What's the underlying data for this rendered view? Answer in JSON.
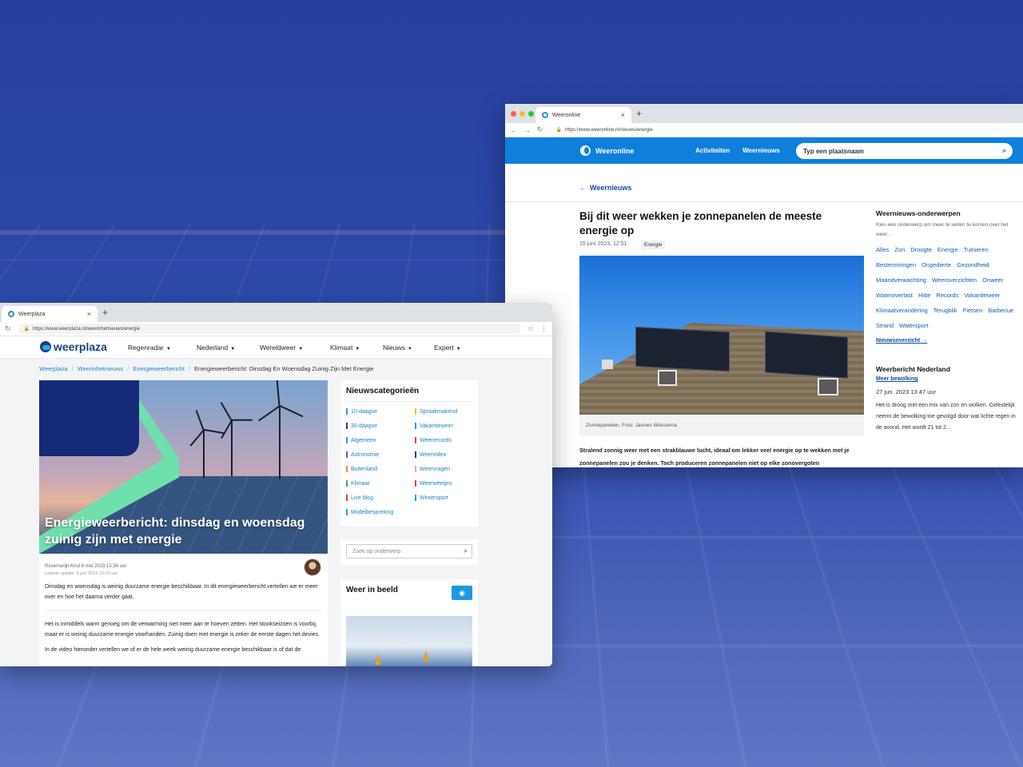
{
  "weeronline": {
    "tab_title": "Weeronline",
    "url": "https://www.weeronline.nl/nieuws/energie",
    "logo": "Weeronline",
    "nav": [
      "Activiteiten",
      "Weernieuws"
    ],
    "search_placeholder": "Typ een plaatsnaam",
    "back_label": "Weernieuws",
    "article": {
      "title": "Bij dit weer wekken je zonnepanelen de meeste energie op",
      "date": "15 juni 2023, 12:51",
      "tag": "Energie",
      "caption": "Zonnepanelen. Foto: Jannes Wiersema",
      "lead": "Stralend zonnig weer met een strakblauwe lucht, ideaal om lekker veel energie op te wekken met je zonnepanelen zou je denken. Toch produceren zonnepanelen niet op elke zonovergoten"
    },
    "sidebar": {
      "heading": "Weernieuws-onderwerpen",
      "subtitle": "Kies een onderwerp om meer te weten te komen over het weer...",
      "topics": [
        "Alles",
        "Zon",
        "Droogte",
        "Energie",
        "Tuinieren",
        "Bestemmingen",
        "Ongedierte",
        "Gezondheid",
        "Maandverwachting",
        "Weeroverzichten",
        "Onweer",
        "Wateroverlast",
        "Hitte",
        "Records",
        "Vakantieweer",
        "Klimaatverandering",
        "Terugblik",
        "Fietsen",
        "Barbecue",
        "Strand",
        "Watersport"
      ],
      "more_link": "Nieuwsoverzicht",
      "forecast_heading": "Weerbericht Nederland",
      "forecast_link": "Meer bewolking",
      "forecast_time": "27 jun. 2023 13:47 uur",
      "forecast_text": "Het is droog met een mix van zon en wolken. Geleidelijk neemt de bewolking toe gevolgd door wat lichte regen in de avond. Het wordt 21 tot 2..."
    }
  },
  "weerplaza": {
    "tab_title": "Weerplaza",
    "url": "https://www.weerplaza.nl/weerinhetnieuws/energie",
    "logo": "weerplaza",
    "nav": [
      "Regenradar",
      "Nederland",
      "Wereldweer",
      "Klimaat",
      "Nieuws",
      "Expert"
    ],
    "breadcrumbs": [
      "Weerplaza",
      "Weerinhetnieuws",
      "Energieweerbericht",
      "Energieweerbericht: Dinsdag En Woensdag Zuinig Zijn Met Energie"
    ],
    "hero_title": "Energieweerbericht: dinsdag en woensdag zuinig zijn met energie",
    "author": "Rosemarijn Knol 8 mei 2023 15:36 uur",
    "updated": "Laatste update: 6 juni 2023 10:23 uur",
    "intro": "Dinsdag en woensdag is weinig duurzame energie beschikbaar. In dit energieweerbericht vertellen we er meer over en hoe het daarna verder gaat.",
    "body1": "Het is inmiddels warm genoeg om de verwarming niet meer aan te hoeven zetten. Het stookseizoen is voorbij, maar er is weinig duurzame energie voorhanden. Zuinig doen met energie is zeker de eerste dagen het devies.",
    "body2": "In de video hieronder vertellen we of er de hele week weinig duurzame energie beschikbaar is of dat de",
    "categories_heading": "Nieuwscategorieën",
    "categories": [
      {
        "label": "10-daagse",
        "color": "#2a9fe0"
      },
      {
        "label": "Spraakmakend",
        "color": "#f2c12e"
      },
      {
        "label": "30-daagse",
        "color": "#1c3f80"
      },
      {
        "label": "Vakantieweer",
        "color": "#2a9fe0"
      },
      {
        "label": "Algemeen",
        "color": "#2a9fe0"
      },
      {
        "label": "Weerrecords",
        "color": "#e0483e"
      },
      {
        "label": "Astronomie",
        "color": "#8a4cc2"
      },
      {
        "label": "Weervideo",
        "color": "#1c3f80"
      },
      {
        "label": "Buitenland",
        "color": "#f28a2e"
      },
      {
        "label": "Weervragen",
        "color": "#f2a0c0"
      },
      {
        "label": "Klimaat",
        "color": "#3ab54a"
      },
      {
        "label": "Weerweetjes",
        "color": "#e0483e"
      },
      {
        "label": "Live blog",
        "color": "#e0483e"
      },
      {
        "label": "Wintersport",
        "color": "#2a9fe0"
      },
      {
        "label": "Modelbespreking",
        "color": "#2a9fe0"
      }
    ],
    "search_placeholder": "Zoek op onderwerp",
    "gallery_heading": "Weer in beeld"
  }
}
